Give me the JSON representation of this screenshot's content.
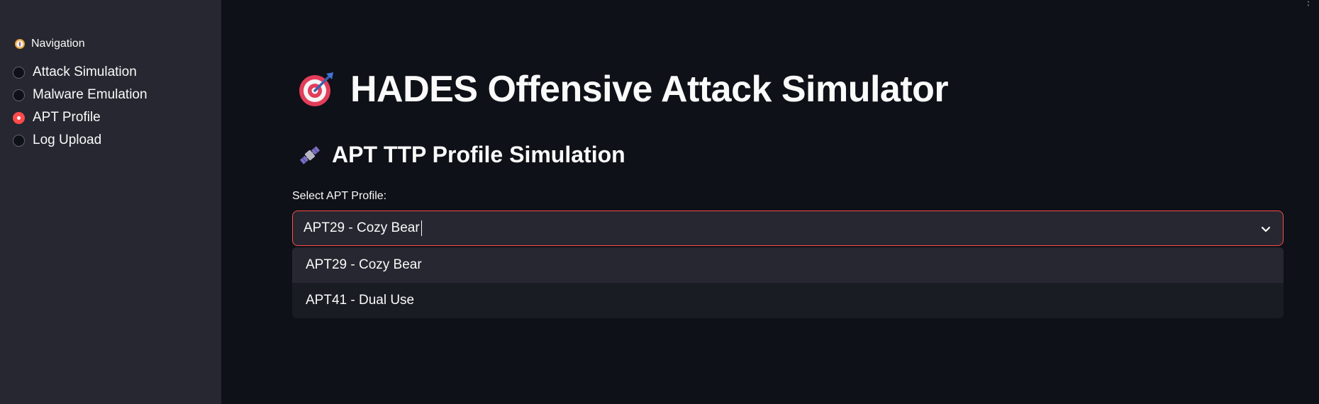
{
  "sidebar": {
    "nav_label": "Navigation",
    "nav_icon": "compass-icon",
    "items": [
      {
        "label": "Attack Simulation",
        "selected": false
      },
      {
        "label": "Malware Emulation",
        "selected": false
      },
      {
        "label": "APT Profile",
        "selected": true
      },
      {
        "label": "Log Upload",
        "selected": false
      }
    ]
  },
  "main": {
    "title": "HADES Offensive Attack Simulator",
    "title_icon": "bullseye-dart-icon",
    "subtitle": "APT TTP Profile Simulation",
    "subtitle_icon": "satellite-icon",
    "select": {
      "label": "Select APT Profile:",
      "value": "APT29 - Cozy Bear",
      "options": [
        "APT29 - Cozy Bear",
        "APT41 - Dual Use"
      ],
      "highlighted_index": 0
    }
  },
  "colors": {
    "accent": "#ff4b4b",
    "background": "#0e1117",
    "sidebar": "#262730",
    "text": "#fafafa"
  }
}
